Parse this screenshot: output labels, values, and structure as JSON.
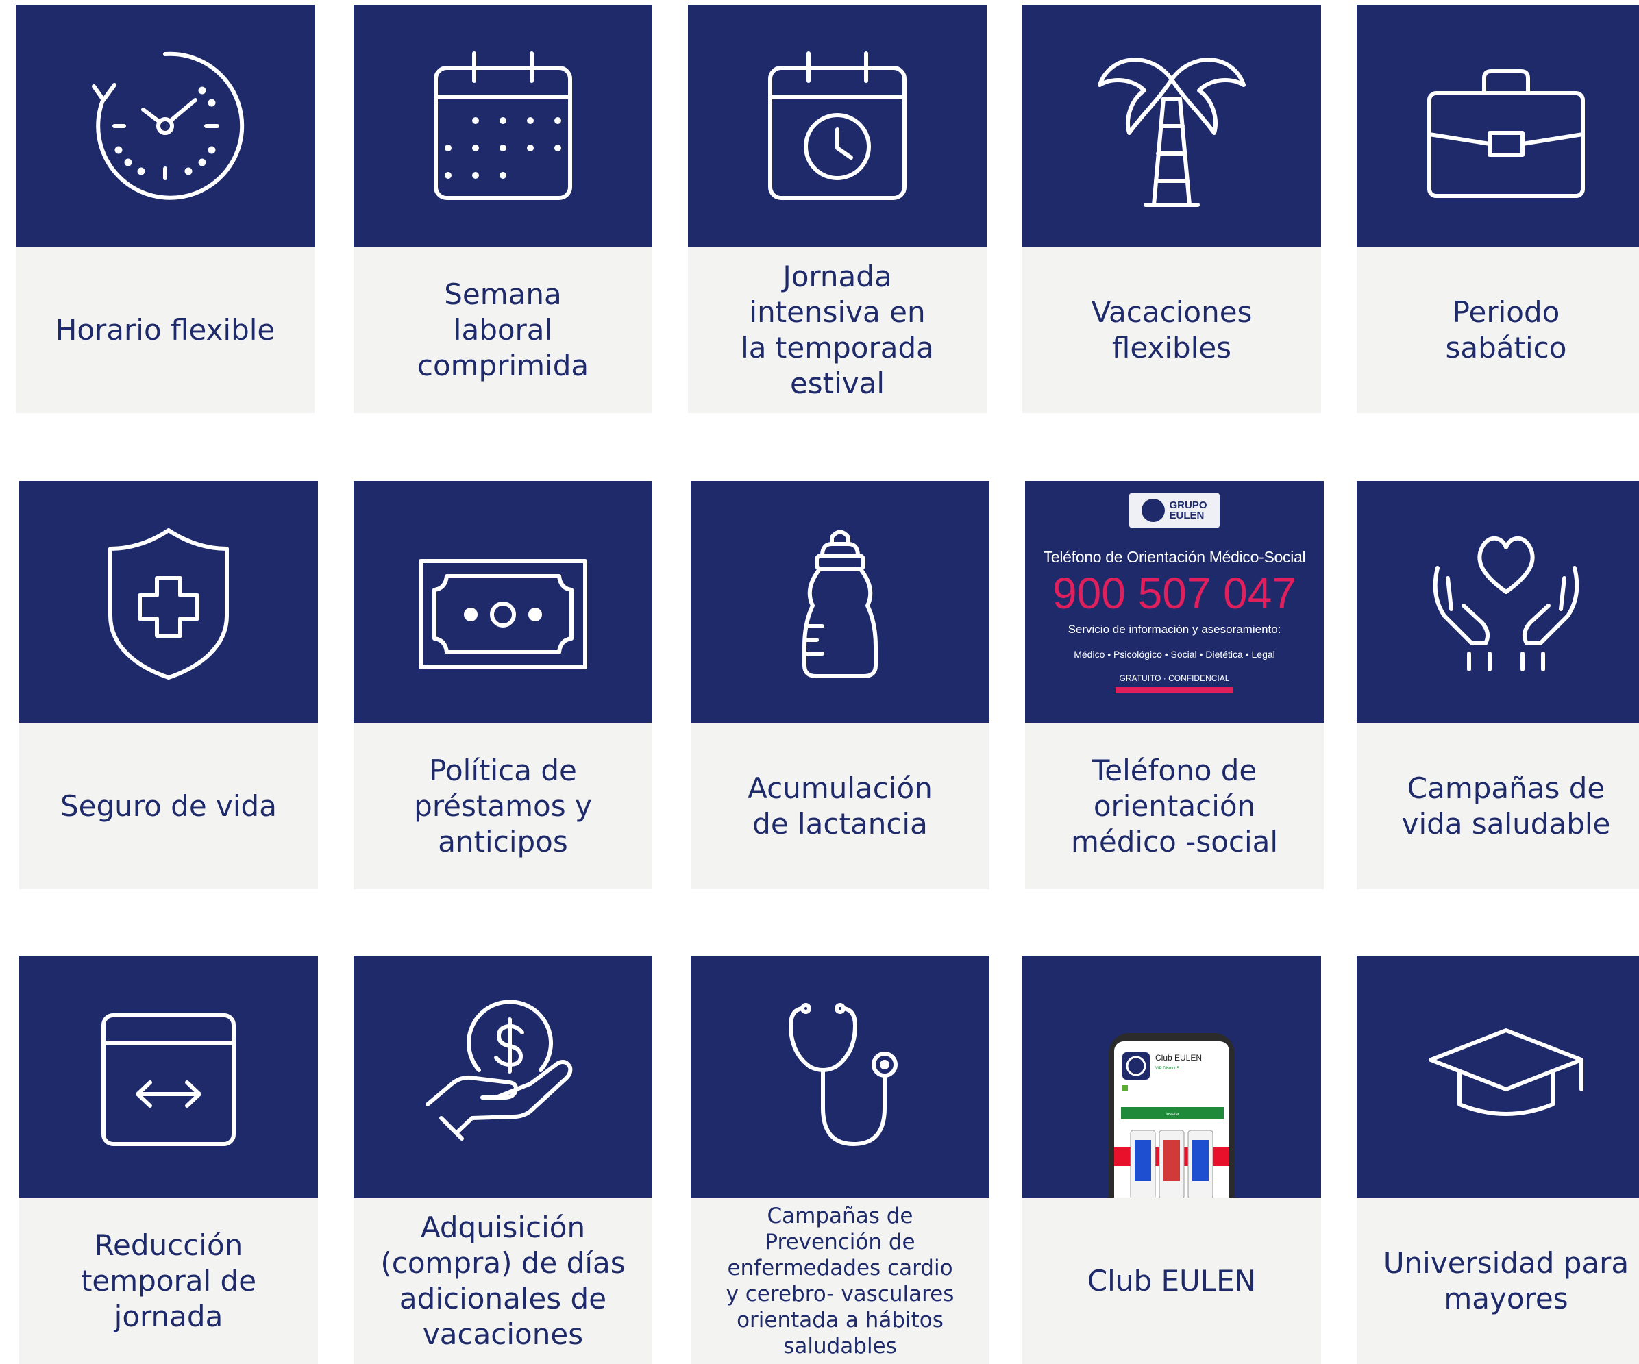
{
  "colors": {
    "navy": "#1e2a6a",
    "label_bg": "#f3f3f2",
    "label_text": "#1e2a6a",
    "accent": "#e0205c"
  },
  "cards": [
    {
      "icon": "clock-icon",
      "label": "Horario flexible"
    },
    {
      "icon": "calendar-icon",
      "label": "Semana\nlaboral\ncomprimida"
    },
    {
      "icon": "calendar-clock-icon",
      "label": "Jornada\nintensiva en\nla temporada\nestival"
    },
    {
      "icon": "palm-tree-icon",
      "label": "Vacaciones\nflexibles"
    },
    {
      "icon": "briefcase-icon",
      "label": "Periodo\nsabático"
    },
    {
      "icon": "shield-plus-icon",
      "label": "Seguro de vida"
    },
    {
      "icon": "banknote-icon",
      "label": "Política de\npréstamos y\nanticipos"
    },
    {
      "icon": "baby-bottle-icon",
      "label": "Acumulación\nde lactancia"
    },
    {
      "icon": "phone-promo-image",
      "label": "Teléfono de\norientación\nmédico -social"
    },
    {
      "icon": "hands-heart-icon",
      "label": "Campañas de\nvida saludable"
    },
    {
      "icon": "calendar-arrows-icon",
      "label": "Reducción\ntemporal de\njornada"
    },
    {
      "icon": "hand-coin-icon",
      "label": "Adquisición\n(compra) de días\nadicionales de\nvacaciones"
    },
    {
      "icon": "stethoscope-icon",
      "label": "Campañas de\nPrevención de\nenfermedades cardio\ny cerebro- vasculares\norientada a  hábitos\nsaludables"
    },
    {
      "icon": "smartphone-app-icon",
      "label": "Club EULEN"
    },
    {
      "icon": "graduation-cap-icon",
      "label": "Universidad para\nmayores"
    }
  ],
  "promo": {
    "logo_text": "GRUPO\nEULEN",
    "title": "Teléfono de Orientación Médico-Social",
    "phone": "900 507 047",
    "subtitle": "Servicio de información y asesoramiento:",
    "services": "Médico • Psicológico • Social • Dietética • Legal",
    "footer": "GRATUITO · CONFIDENCIAL"
  },
  "app_screen": {
    "app_name": "Club EULEN",
    "developer": "VIP District S.L.",
    "install_label": "Instalar"
  }
}
